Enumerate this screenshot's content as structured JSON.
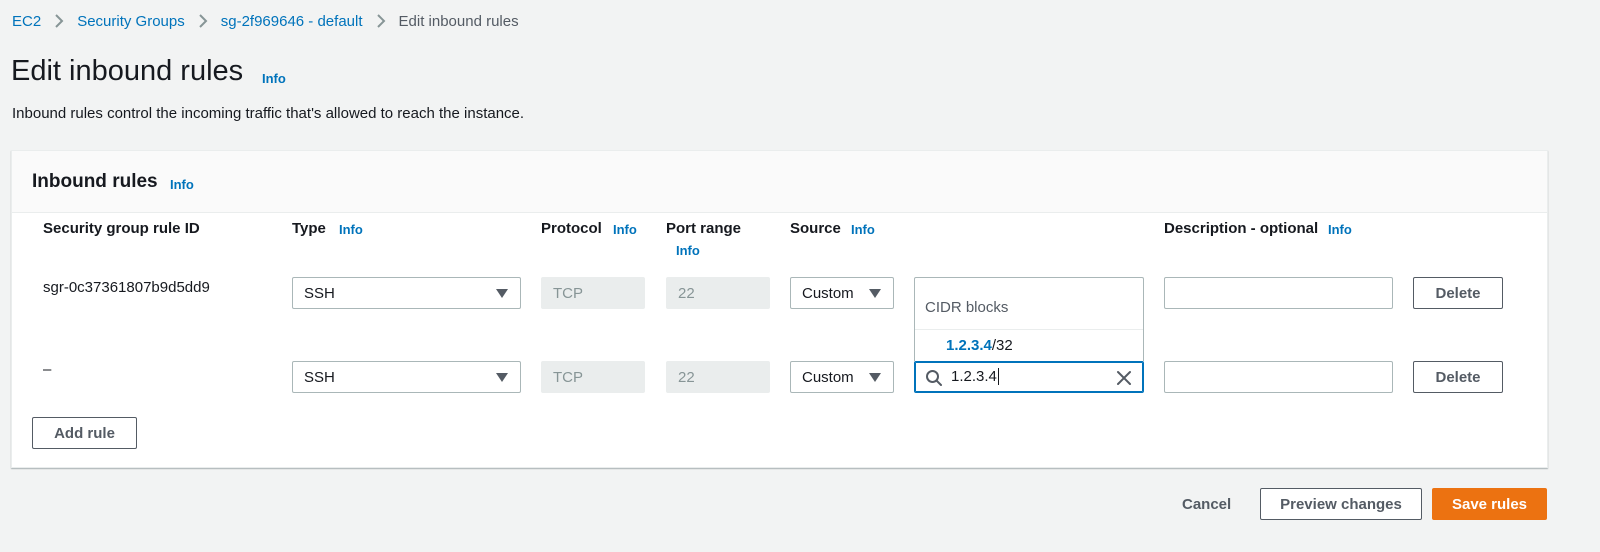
{
  "breadcrumb": {
    "items": [
      "EC2",
      "Security Groups",
      "sg-2f969646 - default"
    ],
    "current": "Edit inbound rules"
  },
  "page": {
    "title": "Edit inbound rules",
    "info_label": "Info",
    "description": "Inbound rules control the incoming traffic that's allowed to reach the instance."
  },
  "panel": {
    "title": "Inbound rules",
    "info_label": "Info",
    "columns": {
      "rule_id": "Security group rule ID",
      "type": "Type",
      "protocol": "Protocol",
      "port_range": "Port range",
      "source": "Source",
      "description": "Description - optional"
    },
    "info_label_col": "Info",
    "rows": [
      {
        "rule_id": "sgr-0c37361807b9d5dd9",
        "type": "SSH",
        "protocol": "TCP",
        "port_range": "22",
        "source_type": "Custom",
        "description": "",
        "delete_label": "Delete"
      },
      {
        "rule_id": "–",
        "type": "SSH",
        "protocol": "TCP",
        "port_range": "22",
        "source_type": "Custom",
        "source_value": "1.2.3.4",
        "description": "",
        "delete_label": "Delete"
      }
    ],
    "source_dropdown": {
      "group_label": "CIDR blocks",
      "option_match": "1.2.3.4",
      "option_rest": "/32"
    },
    "add_rule_label": "Add rule"
  },
  "footer": {
    "cancel_label": "Cancel",
    "preview_label": "Preview changes",
    "save_label": "Save rules"
  },
  "colors": {
    "link": "#0073bb",
    "primary": "#ec7211",
    "background": "#f2f3f3"
  },
  "icons": [
    "chevron-right-icon",
    "caret-down-icon",
    "search-icon",
    "clear-icon"
  ]
}
